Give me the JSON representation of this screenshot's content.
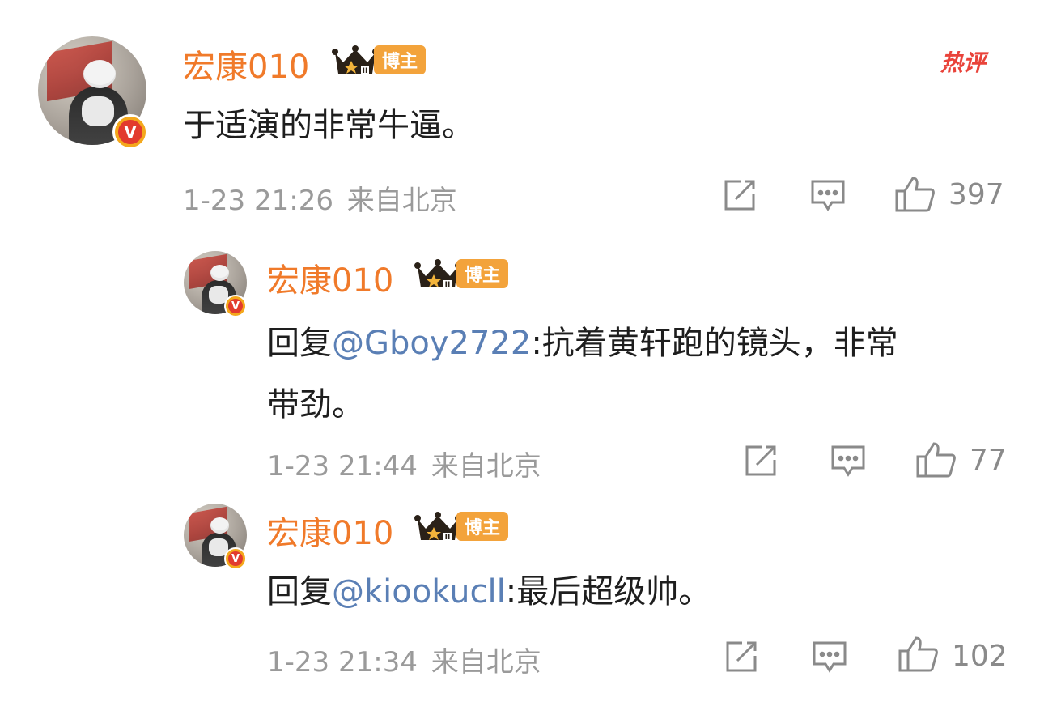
{
  "hot_label": "热评",
  "comments": [
    {
      "username": "宏康010",
      "badge": "博主",
      "content": "于适演的非常牛逼。",
      "time": "1-23 21:26",
      "location": "来自北京",
      "likes": "397"
    },
    {
      "username": "宏康010",
      "badge": "博主",
      "reply_prefix": "回复",
      "mention": "@Gboy2722",
      "content_line1": ":抗着黄轩跑的镜头，非常",
      "content_line2": "带劲。",
      "time": "1-23 21:44",
      "location": "来自北京",
      "likes": "77"
    },
    {
      "username": "宏康010",
      "badge": "博主",
      "reply_prefix": "回复",
      "mention": "@kiookucll",
      "content": ":最后超级帅。",
      "time": "1-23 21:34",
      "location": "来自北京",
      "likes": "102"
    }
  ],
  "icons": {
    "share": "share-icon",
    "comment": "comment-icon",
    "like": "thumbs-up-icon"
  },
  "colors": {
    "username": "#f07a2a",
    "mention": "#5a7fb5",
    "meta": "#9a9a9a",
    "hot": "#e9433a",
    "badge": "#f3a33b"
  }
}
